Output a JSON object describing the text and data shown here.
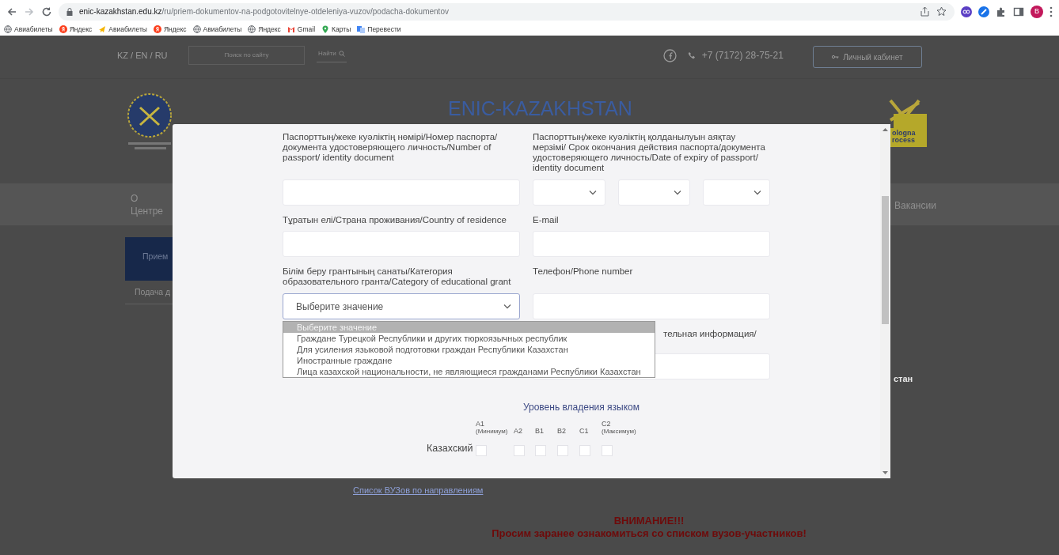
{
  "browser": {
    "url_domain": "enic-kazakhstan.edu.kz",
    "url_path": "/ru/priem-dokumentov-na-podgotovitelnye-otdeleniya-vuzov/podacha-dokumentov",
    "profile_initial": "B",
    "bookmarks": [
      {
        "kind": "globe",
        "label": "Авиабилеты"
      },
      {
        "kind": "yandex",
        "label": "Яндекс"
      },
      {
        "kind": "plane",
        "label": "Авиабилеты"
      },
      {
        "kind": "yandex",
        "label": "Яндекс"
      },
      {
        "kind": "globe",
        "label": "Авиабилеты"
      },
      {
        "kind": "globe",
        "label": "Яндекс"
      },
      {
        "kind": "gmail",
        "label": "Gmail"
      },
      {
        "kind": "maps",
        "label": "Карты"
      },
      {
        "kind": "translate",
        "label": "Перевести"
      }
    ]
  },
  "site": {
    "language_switch": "KZ / EN / RU",
    "search_placeholder": "Поиск по сайту",
    "search_button": "Найти",
    "phone": "+7 (7172) 28-75-21",
    "cabinet_button": "Личный кабинет",
    "title": "ENIC-KAZAKHSTAN",
    "bologna_text": [
      "ologna",
      "rocess"
    ],
    "nav": [
      {
        "label": "О Центре"
      },
      {
        "label": "Вакансии"
      }
    ],
    "sidebar": [
      {
        "label": "Прием",
        "selected": true
      },
      {
        "label": "Подача д",
        "selected": false
      }
    ],
    "side_text": "стан",
    "list_link": "Список ВУЗов по направлениям",
    "warning_title": "ВНИМАНИЕ!!!",
    "warning_text": "Просим заранее ознакомиться со списком вузов-участников!"
  },
  "modal": {
    "rows": [
      {
        "fields": [
          {
            "kind": "input",
            "label": "Паспорттың/жеке куәліктің нөмірі/Номер паспорта/ документа удостоверяющего личность/Number of passport/ identity document"
          },
          {
            "kind": "date",
            "label": "Паспорттың/жеке куәліктің қолданылуын аяқтау мерзімі/ Срок окончания действия паспорта/документа удостоверяющего личность/Date of expiry of passport/ identity document"
          }
        ]
      },
      {
        "fields": [
          {
            "kind": "input",
            "label": "Тұратын елі/Страна проживания/Country of residence"
          },
          {
            "kind": "input",
            "label": "E-mail"
          }
        ]
      },
      {
        "fields": [
          {
            "kind": "select",
            "label": "Білім беру грантының санаты/Категория образовательного гранта/Category of educational grant",
            "value": "Выберите значение",
            "expanded": true,
            "options": [
              {
                "label": "Выберите значение",
                "selected": true
              },
              {
                "label": "Граждане Турецкой Республики и других тюркоязычных республик",
                "selected": false
              },
              {
                "label": "Для усиления языковой подготовки граждан Республики Казахстан",
                "selected": false
              },
              {
                "label": "Иностранные граждане",
                "selected": false
              },
              {
                "label": "Лица казахской национальности, не являющиеся гражданами Республики Казахстан",
                "selected": false
              }
            ]
          },
          {
            "kind": "input",
            "label": "Телефон/Phone number"
          }
        ]
      },
      {
        "fields": [
          {
            "kind": "input",
            "label": "тельная информация/"
          }
        ]
      }
    ],
    "proficiency": {
      "title": "Уровень владения языком",
      "levels": [
        {
          "label": "A1",
          "note": "(Минимум)"
        },
        {
          "label": "A2"
        },
        {
          "label": "B1"
        },
        {
          "label": "B2"
        },
        {
          "label": "C1"
        },
        {
          "label": "C2",
          "note": "(Максимум)"
        }
      ],
      "languages": [
        {
          "name": "Казахский",
          "checks": [
            {
              "checked": false
            },
            {
              "checked": false
            },
            {
              "checked": false
            },
            {
              "checked": false
            },
            {
              "checked": false
            },
            {
              "checked": false
            }
          ]
        }
      ]
    }
  }
}
